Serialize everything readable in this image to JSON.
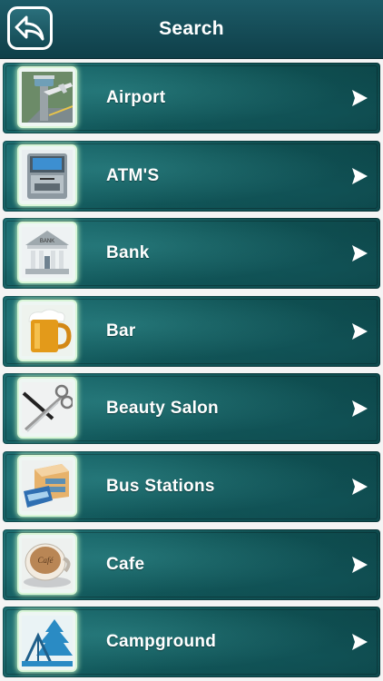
{
  "header": {
    "title": "Search",
    "back_icon": "back-arrow-icon"
  },
  "items": [
    {
      "label": "Airport",
      "icon": "airport-icon"
    },
    {
      "label": "ATM'S",
      "icon": "atm-icon"
    },
    {
      "label": "Bank",
      "icon": "bank-icon"
    },
    {
      "label": "Bar",
      "icon": "beer-icon"
    },
    {
      "label": "Beauty Salon",
      "icon": "scissors-icon"
    },
    {
      "label": "Bus Stations",
      "icon": "bus-station-icon"
    },
    {
      "label": "Cafe",
      "icon": "coffee-cup-icon"
    },
    {
      "label": "Campground",
      "icon": "tent-icon"
    }
  ],
  "icon_texts": {
    "bank_sign": "BANK",
    "cafe_sign": "Café"
  },
  "colors": {
    "header": "#134a55",
    "card": "#105355",
    "glow": "#d9f6d8"
  }
}
